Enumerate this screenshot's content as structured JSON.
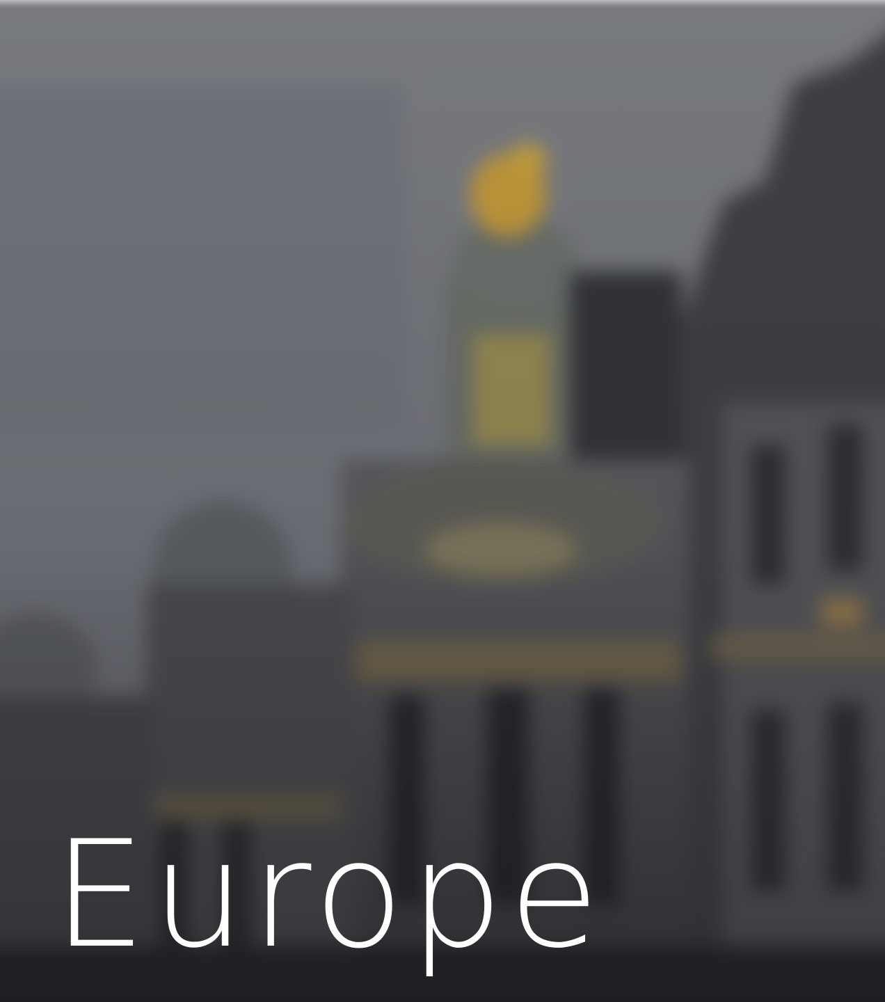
{
  "card": {
    "title": "Europe"
  },
  "colors": {
    "title": "#ffffff",
    "sky": "#7d7f84",
    "stone": "#8f8c85",
    "gold": "#c49a3a",
    "shadow": "#2b2d33"
  }
}
